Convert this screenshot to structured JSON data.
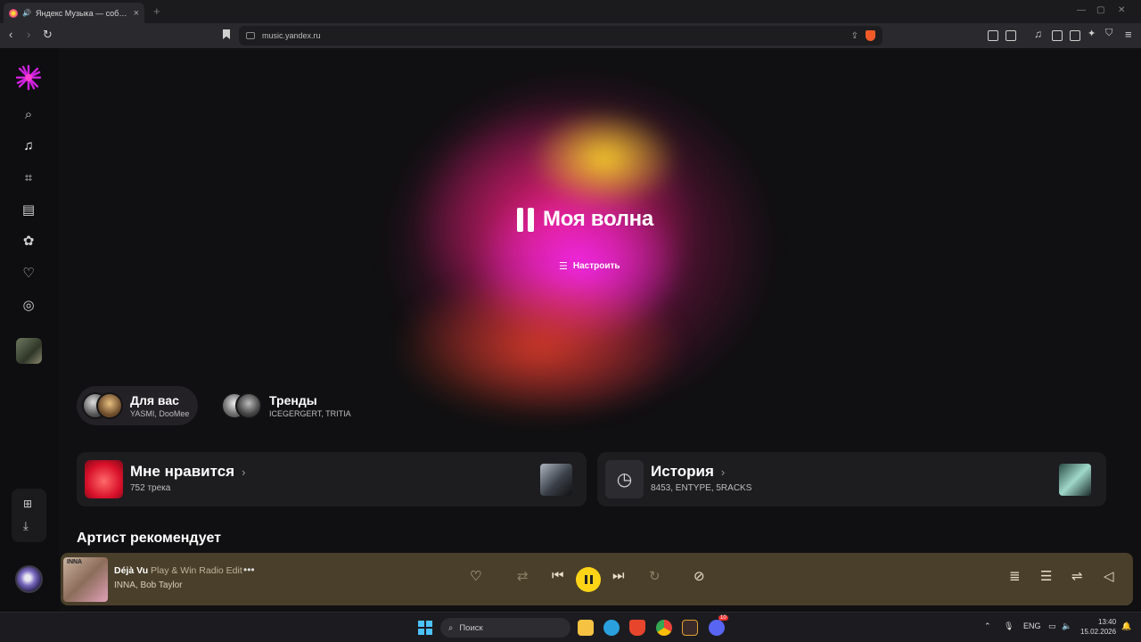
{
  "browser": {
    "tab_title": "Яндекс Музыка — собирае...",
    "url": "music.yandex.ru"
  },
  "wave": {
    "title": "Моя волна",
    "tune_label": "Настроить"
  },
  "chips": [
    {
      "title": "Для вас",
      "subtitle": "YASMI, DooMee"
    },
    {
      "title": "Тренды",
      "subtitle": "ICEGERGERT, TRITIA"
    }
  ],
  "cards": [
    {
      "title": "Мне нравится",
      "subtitle": "752 трека"
    },
    {
      "title": "История",
      "subtitle": "8453, ENTYPE, 5RACKS"
    }
  ],
  "section_title": "Артист рекомендует",
  "player": {
    "cover_tag": "INNA",
    "track": "Déjà Vu",
    "version": "Play & Win Radio Edit",
    "artists": "INNA, Bob Taylor"
  },
  "taskbar": {
    "search_placeholder": "Поиск",
    "lang": "ENG",
    "time": "13:40",
    "date": "15.02.2026",
    "badge": "10"
  },
  "colors": {
    "accent_yellow": "#ffd417",
    "player_bg": "#4a3f2a",
    "blob_magenta": "#f028e6"
  }
}
